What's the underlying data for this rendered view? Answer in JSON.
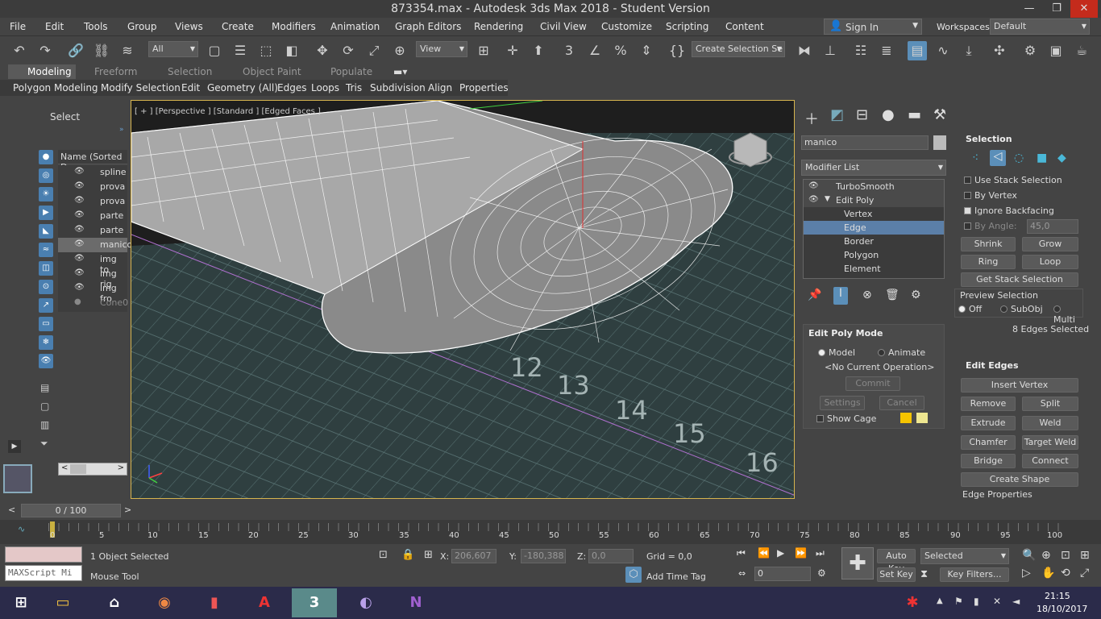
{
  "window": {
    "title": "873354.max - Autodesk 3ds Max 2018 - Student Version"
  },
  "menu": [
    "File",
    "Edit",
    "Tools",
    "Group",
    "Views",
    "Create",
    "Modifiers",
    "Animation",
    "Graph Editors",
    "Rendering",
    "Civil View",
    "Customize",
    "Scripting",
    "Content"
  ],
  "signin": "Sign In",
  "workspaces": {
    "label": "Workspaces:",
    "value": "Default"
  },
  "toolbar": {
    "filter": "All",
    "view": "View",
    "selset": "Create Selection Se"
  },
  "ribbon": {
    "tabs": [
      "Modeling",
      "Freeform",
      "Selection",
      "Object Paint",
      "Populate"
    ],
    "items": [
      "Polygon Modeling",
      "Modify Selection",
      "Edit",
      "Geometry (All)",
      "Edges",
      "Loops",
      "Tris",
      "Subdivision",
      "Align",
      "Properties"
    ]
  },
  "scene": {
    "select_label": "Select",
    "header": "Name (Sorted De",
    "rows": [
      "spline",
      "prova",
      "prova",
      "parte",
      "parte",
      "manico",
      "img to",
      "img rig",
      "img fro",
      "Cone0"
    ]
  },
  "viewport": {
    "label": "[ + ] [Perspective ] [Standard ] [Edged Faces ]",
    "rulers": [
      "12",
      "13",
      "14",
      "15",
      "16"
    ]
  },
  "command": {
    "object_name": "manico",
    "modifier_list": "Modifier List",
    "stack": [
      "TurboSmooth",
      "Edit Poly",
      "Vertex",
      "Edge",
      "Border",
      "Polygon",
      "Element"
    ]
  },
  "selection": {
    "title": "Selection",
    "use_stack": "Use Stack Selection",
    "by_vertex": "By Vertex",
    "ignore_backfacing": "Ignore Backfacing",
    "by_angle": "By Angle:",
    "angle": "45,0",
    "shrink": "Shrink",
    "grow": "Grow",
    "ring": "Ring",
    "loop": "Loop",
    "get_stack": "Get Stack Selection",
    "preview": "Preview Selection",
    "off": "Off",
    "subobj": "SubObj",
    "multi": "Multi",
    "count": "8 Edges Selected"
  },
  "editpoly": {
    "title": "Edit Poly Mode",
    "model": "Model",
    "animate": "Animate",
    "noop": "<No Current Operation>",
    "commit": "Commit",
    "settings": "Settings",
    "cancel": "Cancel",
    "show_cage": "Show Cage"
  },
  "edges": {
    "title": "Edit Edges",
    "insert": "Insert Vertex",
    "remove": "Remove",
    "split": "Split",
    "extrude": "Extrude",
    "weld": "Weld",
    "chamfer": "Chamfer",
    "target_weld": "Target Weld",
    "bridge": "Bridge",
    "connect": "Connect",
    "create_shape": "Create Shape",
    "edge_props": "Edge Properties"
  },
  "timeline": {
    "frame": "0 / 100",
    "ticks": [
      "0",
      "5",
      "10",
      "15",
      "20",
      "25",
      "30",
      "35",
      "40",
      "45",
      "50",
      "55",
      "60",
      "65",
      "70",
      "75",
      "80",
      "85",
      "90",
      "95",
      "100"
    ]
  },
  "status": {
    "selected": "1 Object Selected",
    "tool": "Mouse Tool",
    "x_label": "X:",
    "x": "206,607",
    "y_label": "Y:",
    "y": "-180,388",
    "z_label": "Z:",
    "z": "0,0",
    "grid": "Grid = 0,0",
    "add_time": "Add Time Tag",
    "autokey": "Auto Key",
    "setkey": "Set Key",
    "selected_dd": "Selected",
    "keyfilters": "Key Filters...",
    "frame": "0",
    "script": "MAXScript Mi"
  },
  "clock": {
    "time": "21:15",
    "date": "18/10/2017"
  }
}
